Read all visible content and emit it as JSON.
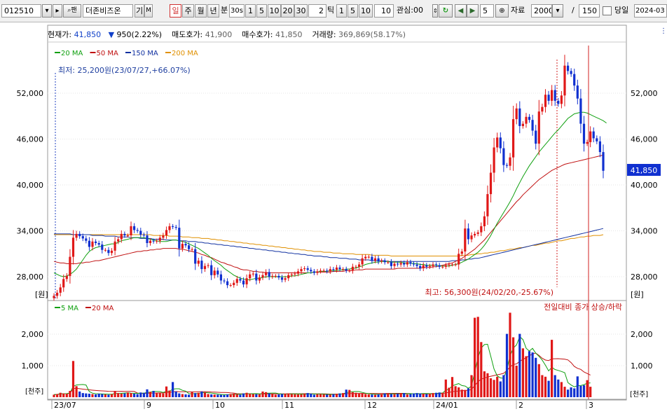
{
  "toolbar": {
    "code": "012510",
    "name": "더존비즈온",
    "find_icon": "search-icon",
    "btn_gi": "기",
    "btn_m": "M",
    "periods": [
      "일",
      "주",
      "월",
      "년"
    ],
    "period_selected": "일",
    "min_label": "분",
    "min_value": "30s",
    "minutes": [
      "1",
      "5",
      "10",
      "20",
      "30"
    ],
    "tick_value": "2",
    "tick_label": "틱",
    "ticks": [
      "1",
      "5",
      "10"
    ],
    "tick_custom": "10",
    "watch_label": "관심:00",
    "step_value": "5",
    "data_label": "자료",
    "data_count": "2000",
    "slash": "/",
    "display_count": "150",
    "today_label": "당일",
    "date_value": "2024-03"
  },
  "info": {
    "price_label": "현재가:",
    "price": "41,850",
    "change_arrow": "▼",
    "change": "950(2.22%)",
    "ask_label": "매도호가:",
    "ask": "41,900",
    "bid_label": "매수호가:",
    "bid": "41,850",
    "volume_label": "거래량:",
    "volume": "369,869(58.17%)"
  },
  "legend_price": [
    {
      "label": "20 MA",
      "color": "#10a010"
    },
    {
      "label": "50 MA",
      "color": "#c01010"
    },
    {
      "label": "150 MA",
      "color": "#1030a0"
    },
    {
      "label": "200 MA",
      "color": "#e09000"
    }
  ],
  "legend_volume": [
    {
      "label": "5 MA",
      "color": "#10a010"
    },
    {
      "label": "20 MA",
      "color": "#c01010"
    }
  ],
  "annotations": {
    "low": "최저: 25,200원(23/07/27,+66.07%)",
    "high": "최고: 56,300원(24/02/20,-25.67%)",
    "volume_note": "전일대비 종가 상승/하락"
  },
  "price_axis": {
    "ticks": [
      "52,000",
      "46,000",
      "40,000",
      "34,000",
      "28,000"
    ],
    "unit": "[원]",
    "current": "41,850"
  },
  "volume_axis": {
    "ticks": [
      "2,000",
      "1,000"
    ],
    "unit": "[천주]"
  },
  "x_axis": {
    "labels": [
      "23/07",
      "9",
      "10",
      "11",
      "12",
      "24/01",
      "2",
      "3"
    ]
  },
  "colors": {
    "up": "#e01818",
    "down": "#1030d0",
    "ma20": "#10a010",
    "ma50": "#c01010",
    "ma150": "#1030a0",
    "ma200": "#e09000",
    "vline": "#d02020"
  },
  "chart_data": {
    "type": "candlestick",
    "price_range": [
      25000,
      57000
    ],
    "volume_range_thousand": [
      0,
      2800
    ],
    "closes": [
      25500,
      25900,
      26600,
      27700,
      28100,
      30600,
      33100,
      33600,
      33300,
      33000,
      32700,
      31900,
      32600,
      32400,
      32200,
      31500,
      31500,
      31100,
      31400,
      32600,
      32900,
      33600,
      33400,
      33400,
      34600,
      34100,
      34000,
      33500,
      33400,
      32400,
      32700,
      32600,
      32700,
      33100,
      33400,
      34100,
      34600,
      34500,
      34400,
      31700,
      32300,
      32100,
      31600,
      31600,
      29700,
      30100,
      29000,
      29400,
      29500,
      28200,
      28800,
      28300,
      27500,
      27400,
      26900,
      26900,
      27200,
      27700,
      27500,
      27000,
      27800,
      28300,
      28400,
      27500,
      27900,
      28200,
      28600,
      28000,
      28100,
      28100,
      27900,
      27600,
      27800,
      28200,
      28300,
      28400,
      28700,
      29000,
      29100,
      28900,
      28700,
      28500,
      28700,
      28800,
      28800,
      28700,
      29000,
      28900,
      29200,
      29000,
      29000,
      28800,
      28800,
      29300,
      29300,
      29600,
      30400,
      30600,
      30600,
      30100,
      30400,
      30000,
      30100,
      29900,
      29900,
      29400,
      29700,
      29600,
      29800,
      29600,
      29900,
      29700,
      29600,
      29400,
      29100,
      29500,
      29300,
      29400,
      29600,
      29500,
      29300,
      29300,
      29500,
      29600,
      29600,
      29600,
      31000,
      31300,
      34300,
      32900,
      33400,
      33600,
      33800,
      34600,
      35900,
      38800,
      41600,
      44900,
      46200,
      44800,
      42600,
      42500,
      43600,
      48600,
      50000,
      47700,
      48000,
      48900,
      48500,
      47100,
      45400,
      49600,
      50200,
      51800,
      51000,
      52400,
      51000,
      50600,
      51700,
      55600,
      54900,
      54500,
      53000,
      51300,
      48000,
      45400,
      45600,
      47000,
      46100,
      45700,
      44300,
      41850
    ],
    "volumes_thousand": [
      80,
      100,
      140,
      120,
      110,
      200,
      1150,
      350,
      180,
      130,
      120,
      110,
      100,
      90,
      110,
      100,
      90,
      80,
      95,
      200,
      130,
      110,
      120,
      150,
      130,
      110,
      100,
      150,
      140,
      250,
      170,
      200,
      140,
      130,
      120,
      340,
      210,
      480,
      180,
      120,
      100,
      90,
      80,
      160,
      130,
      140,
      180,
      150,
      100,
      90,
      85,
      80,
      75,
      70,
      90,
      100,
      110,
      90,
      80,
      120,
      140,
      110,
      100,
      95,
      90,
      180,
      160,
      120,
      110,
      80,
      90,
      100,
      110,
      120,
      100,
      95,
      90,
      90,
      100,
      130,
      110,
      80,
      95,
      100,
      90,
      85,
      80,
      95,
      110,
      120,
      130,
      240,
      230,
      160,
      140,
      120,
      110,
      100,
      90,
      85,
      80,
      90,
      100,
      120,
      110,
      100,
      95,
      110,
      120,
      130,
      90,
      100,
      120,
      130,
      120,
      110,
      100,
      110,
      130,
      140,
      150,
      140,
      560,
      300,
      640,
      350,
      310,
      240,
      230,
      280,
      700,
      2520,
      2550,
      1750,
      820,
      760,
      600,
      550,
      650,
      500,
      700,
      2010,
      2680,
      1900,
      1000,
      2010,
      1550,
      1300,
      1460,
      1420,
      1250,
      1050,
      700,
      650,
      520,
      1820,
      700,
      560,
      480,
      330,
      240,
      310,
      280,
      660,
      360,
      380,
      540,
      330
    ],
    "ma20": [
      28500,
      28300,
      28100,
      28000,
      28100,
      28300,
      28600,
      29000,
      29600,
      30200,
      30800,
      31300,
      31600,
      31800,
      31900,
      32000,
      32100,
      32200,
      32300,
      32300,
      32500,
      32700,
      32800,
      32900,
      33000,
      33100,
      33100,
      33100,
      33100,
      33000,
      32900,
      32800,
      32700,
      32600,
      32600,
      32600,
      32700,
      32800,
      32800,
      32700,
      32600,
      32500,
      32300,
      32100,
      31900,
      31700,
      31400,
      31100,
      30800,
      30400,
      30100,
      29800,
      29500,
      29100,
      28800,
      28500,
      28200,
      28000,
      27800,
      27700,
      27600,
      27600,
      27700,
      27800,
      27800,
      27900,
      28000,
      28000,
      28000,
      28000,
      28000,
      28000,
      28000,
      28000,
      28100,
      28100,
      28200,
      28300,
      28400,
      28500,
      28500,
      28600,
      28600,
      28700,
      28700,
      28700,
      28800,
      28800,
      28800,
      28900,
      28900,
      29000,
      29000,
      29100,
      29100,
      29300,
      29400,
      29600,
      29700,
      29800,
      29900,
      29900,
      30000,
      30000,
      30000,
      29900,
      29900,
      29900,
      29900,
      29800,
      29800,
      29800,
      29700,
      29700,
      29600,
      29600,
      29500,
      29500,
      29500,
      29500,
      29400,
      29400,
      29400,
      29400,
      29500,
      29600,
      29700,
      29900,
      30100,
      30300,
      30600,
      30900,
      31200,
      31600,
      32100,
      32700,
      33400,
      34200,
      35000,
      35700,
      36400,
      37100,
      37800,
      38600,
      39500,
      40300,
      41100,
      41800,
      42500,
      43100,
      43700,
      44300,
      44800,
      45300,
      45800,
      46300,
      46800,
      47200,
      47700,
      48200,
      48700,
      49000,
      49300,
      49400,
      49500,
      49500,
      49400,
      49200,
      49000,
      48800,
      48600,
      48400,
      48100
    ],
    "ma50": [
      30000,
      29900,
      29800,
      29800,
      29700,
      29700,
      29700,
      29700,
      29800,
      29800,
      29900,
      29900,
      30000,
      30100,
      30100,
      30200,
      30300,
      30400,
      30500,
      30600,
      30700,
      30800,
      30900,
      31000,
      31100,
      31200,
      31300,
      31300,
      31400,
      31400,
      31500,
      31500,
      31600,
      31600,
      31700,
      31700,
      31700,
      31700,
      31700,
      31600,
      31600,
      31500,
      31400,
      31300,
      31200,
      31100,
      30900,
      30800,
      30600,
      30500,
      30300,
      30100,
      29900,
      29800,
      29600,
      29500,
      29300,
      29200,
      29000,
      28900,
      28900,
      28800,
      28700,
      28700,
      28600,
      28600,
      28500,
      28500,
      28500,
      28500,
      28500,
      28500,
      28500,
      28500,
      28500,
      28500,
      28500,
      28500,
      28500,
      28500,
      28500,
      28600,
      28600,
      28600,
      28600,
      28600,
      28600,
      28700,
      28700,
      28700,
      28700,
      28800,
      28800,
      28800,
      28900,
      28900,
      28900,
      29000,
      29000,
      29000,
      29000,
      29000,
      29000,
      29000,
      29000,
      29000,
      29000,
      29100,
      29100,
      29100,
      29100,
      29100,
      29100,
      29100,
      29100,
      29200,
      29200,
      29200,
      29300,
      29300,
      29400,
      29500,
      29600,
      29700,
      29800,
      30000,
      30200,
      30400,
      30700,
      31000,
      31300,
      31600,
      32000,
      32400,
      32800,
      33300,
      33800,
      34300,
      34800,
      35300,
      35800,
      36300,
      36800,
      37300,
      37800,
      38200,
      38700,
      39100,
      39500,
      39900,
      40300,
      40700,
      41000,
      41300,
      41600,
      41900,
      42100,
      42300,
      42500,
      42700,
      42800,
      42900,
      43000,
      43100,
      43200,
      43300,
      43400,
      43500,
      43600,
      43700,
      43800,
      43900
    ],
    "ma150": [
      33600,
      33600,
      33600,
      33600,
      33600,
      33600,
      33500,
      33500,
      33500,
      33500,
      33500,
      33500,
      33400,
      33400,
      33400,
      33400,
      33300,
      33300,
      33300,
      33300,
      33200,
      33200,
      33200,
      33200,
      33100,
      33100,
      33100,
      33000,
      33000,
      33000,
      33000,
      32900,
      32900,
      32900,
      32900,
      32800,
      32800,
      32800,
      32800,
      32700,
      32700,
      32700,
      32600,
      32600,
      32600,
      32500,
      32500,
      32400,
      32400,
      32300,
      32300,
      32200,
      32200,
      32100,
      32100,
      32000,
      32000,
      31900,
      31900,
      31800,
      31800,
      31700,
      31700,
      31600,
      31600,
      31500,
      31500,
      31400,
      31400,
      31300,
      31300,
      31200,
      31200,
      31100,
      31100,
      31000,
      31000,
      30900,
      30900,
      30800,
      30800,
      30700,
      30700,
      30700,
      30600,
      30600,
      30500,
      30500,
      30500,
      30400,
      30400,
      30400,
      30300,
      30300,
      30300,
      30200,
      30200,
      30200,
      30200,
      30100,
      30100,
      30100,
      30100,
      30100,
      30000,
      30000,
      30000,
      30000,
      30000,
      30000,
      30000,
      30000,
      30000,
      30000,
      30000,
      30000,
      30000,
      30000,
      30000,
      30000,
      30000,
      30000,
      30000,
      30000,
      30100,
      30100,
      30100,
      30200,
      30200,
      30300,
      30300,
      30400,
      30400,
      30500,
      30600,
      30700,
      30800,
      30900,
      31000,
      31100,
      31200,
      31300,
      31400,
      31500,
      31600,
      31700,
      31800,
      31900,
      32000,
      32100,
      32200,
      32300,
      32400,
      32500,
      32600,
      32700,
      32800,
      32900,
      33000,
      33100,
      33200,
      33300,
      33400,
      33500,
      33600,
      33700,
      33800,
      33900,
      34000,
      34100,
      34200,
      34300
    ],
    "ma200": [
      33500,
      33500,
      33500,
      33500,
      33500,
      33500,
      33500,
      33500,
      33500,
      33500,
      33500,
      33500,
      33500,
      33500,
      33500,
      33500,
      33500,
      33500,
      33500,
      33500,
      33500,
      33500,
      33500,
      33500,
      33500,
      33500,
      33500,
      33500,
      33500,
      33500,
      33500,
      33400,
      33400,
      33400,
      33400,
      33400,
      33300,
      33300,
      33300,
      33300,
      33200,
      33200,
      33200,
      33100,
      33100,
      33100,
      33000,
      33000,
      33000,
      32900,
      32900,
      32800,
      32800,
      32700,
      32700,
      32600,
      32600,
      32500,
      32500,
      32400,
      32400,
      32300,
      32300,
      32200,
      32200,
      32100,
      32100,
      32000,
      32000,
      31900,
      31900,
      31800,
      31800,
      31700,
      31700,
      31600,
      31600,
      31500,
      31500,
      31400,
      31400,
      31300,
      31300,
      31300,
      31200,
      31200,
      31200,
      31100,
      31100,
      31100,
      31000,
      31000,
      31000,
      31000,
      30900,
      30900,
      30900,
      30900,
      30900,
      30800,
      30800,
      30800,
      30800,
      30800,
      30800,
      30700,
      30700,
      30700,
      30700,
      30700,
      30700,
      30700,
      30700,
      30700,
      30700,
      30700,
      30700,
      30700,
      30700,
      30700,
      30700,
      30700,
      30700,
      30700,
      30700,
      30700,
      30700,
      30800,
      30800,
      30800,
      30900,
      30900,
      31000,
      31000,
      31100,
      31100,
      31200,
      31200,
      31300,
      31400,
      31400,
      31500,
      31600,
      31600,
      31700,
      31800,
      31800,
      31900,
      32000,
      32100,
      32100,
      32200,
      32300,
      32400,
      32400,
      32500,
      32600,
      32700,
      32700,
      32800,
      32900,
      33000,
      33000,
      33100,
      33200,
      33200,
      33300,
      33300,
      33400,
      33400,
      33400,
      33500
    ]
  }
}
